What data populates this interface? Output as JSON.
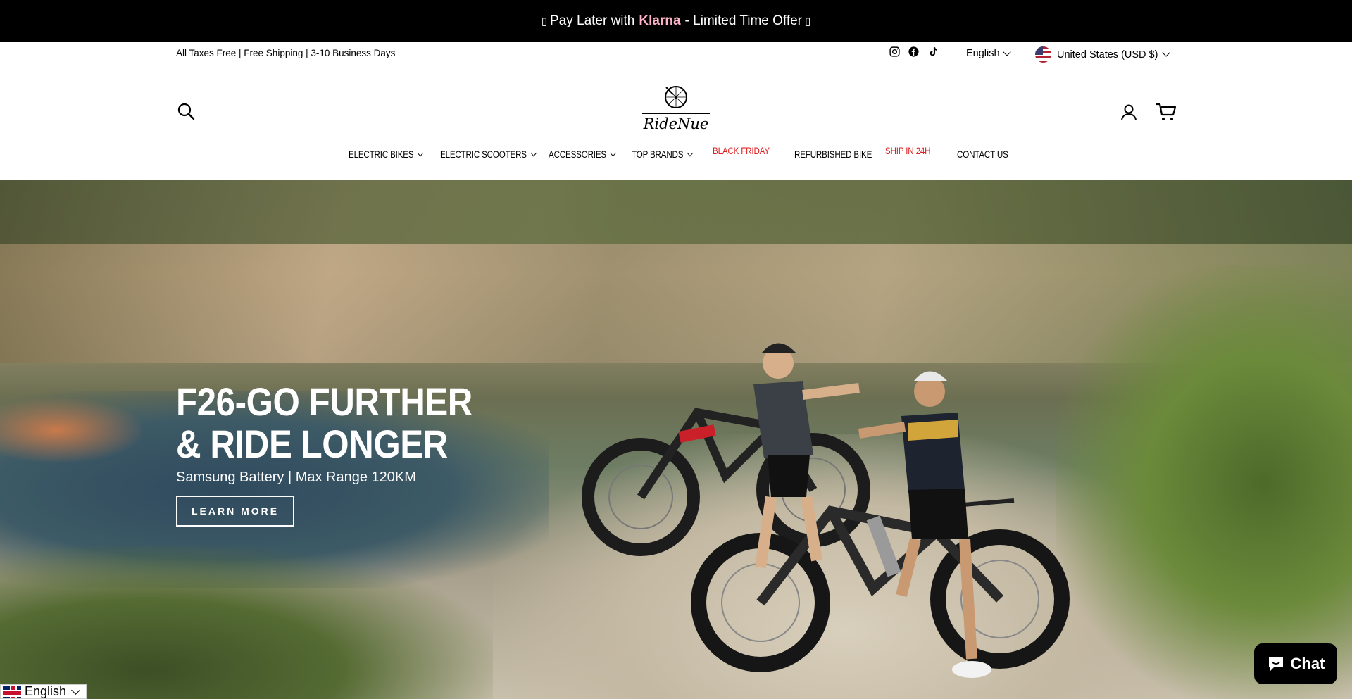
{
  "announcement": {
    "prefix": "Pay Later with",
    "brand": "Klarna",
    "suffix": "- Limited Time Offer",
    "glyph": "▯"
  },
  "utility": {
    "shipping_text": "All Taxes Free | Free Shipping | 3-10 Business Days",
    "social_icons": [
      "instagram-icon",
      "facebook-icon",
      "tiktok-icon"
    ],
    "language": "English",
    "currency": "United States (USD $)"
  },
  "header": {
    "logo_text": "RideNue"
  },
  "nav": {
    "items": [
      {
        "label": "ELECTRIC BIKES",
        "dropdown": true
      },
      {
        "label": "ELECTRIC SCOOTERS",
        "dropdown": true
      },
      {
        "label": "ACCESSORIES",
        "dropdown": true
      },
      {
        "label": "TOP BRANDS",
        "dropdown": true
      },
      {
        "label": "BLACK FRIDAY",
        "highlight": "#e02020"
      },
      {
        "label": "REFURBISHED BIKE"
      },
      {
        "label": "SHIP IN 24H",
        "highlight": "#e02020"
      },
      {
        "label": "CONTACT US"
      }
    ]
  },
  "hero": {
    "title": "F26-GO FURTHER & RIDE LONGER",
    "subtitle": "Samsung Battery | Max Range 120KM",
    "button": "LEARN MORE"
  },
  "chat": {
    "label": "Chat"
  },
  "translate": {
    "language": "English"
  },
  "colors": {
    "klarna": "#ffb3c7",
    "nav_highlight": "#e02020",
    "announcement_bg": "#000000"
  }
}
